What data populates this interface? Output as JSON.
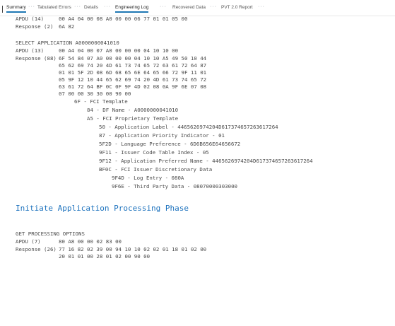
{
  "tabs": {
    "summary": "Summary",
    "tabulated": "Tabulated Errors",
    "details": "Details",
    "engineering": "Engineering Log",
    "recovered": "Recovered Data",
    "pvt": "PVT 2.0 Report",
    "sep": "···"
  },
  "log": {
    "apdu1_label": "APDU (14)",
    "apdu1_bytes": "00 A4 04 00 08 A0 00 00 06 77 01 01 05 00",
    "resp1_label": "Response (2)",
    "resp1_bytes": "6A 82",
    "select_header": "SELECT APPLICATION A0000000041010",
    "apdu2_label": "APDU (13)",
    "apdu2_bytes": "00 A4 04 00 07 A0 00 00 00 04 10 10 00",
    "resp2_label": "Response (88)",
    "resp2_lines": [
      "6F 54 84 07 A0 00 00 00 04 10 10 A5 49 50 10 44",
      "65 62 69 74 20 4D 61 73 74 65 72 63 61 72 64 87",
      "01 01 5F 2D 08 6D 68 65 6E 64 65 66 72 9F 11 01",
      "05 9F 12 10 44 65 62 69 74 20 4D 61 73 74 65 72",
      "63 61 72 64 BF 0C 0F 9F 4D 02 08 0A 9F 6E 07 08",
      "07 00 00 30 30 00 90 00"
    ],
    "tree": [
      "6F - FCI Template",
      "84 - DF Name - A0000000041010",
      "A5 - FCI Proprietary Template",
      "50 - Application Label - 4465626974204D617374657263617264",
      "87 - Application Priority Indicator - 01",
      "5F2D - Language Preference - 6D6B656E64656672",
      "9F11 - Issuer Code Table Index - 05",
      "9F12 - Application Preferred Name - 4465626974204D617374657263617264",
      "BF0C - FCI Issuer Discretionary Data",
      "9F4D - Log Entry - 080A",
      "9F6E - Third Party Data - 08070000303000"
    ],
    "phase_title": "Initiate Application Processing Phase",
    "gpo_header": "GET PROCESSING OPTIONS",
    "apdu3_label": "APDU (7)",
    "apdu3_bytes": "80 A8 00 00 02 83 00",
    "resp3_label": "Response (26)",
    "resp3_lines": [
      "77 16 82 02 39 00 94 10 10 02 02 01 18 01 02 00",
      "20 01 01 00 28 01 02 00 90 00"
    ]
  }
}
